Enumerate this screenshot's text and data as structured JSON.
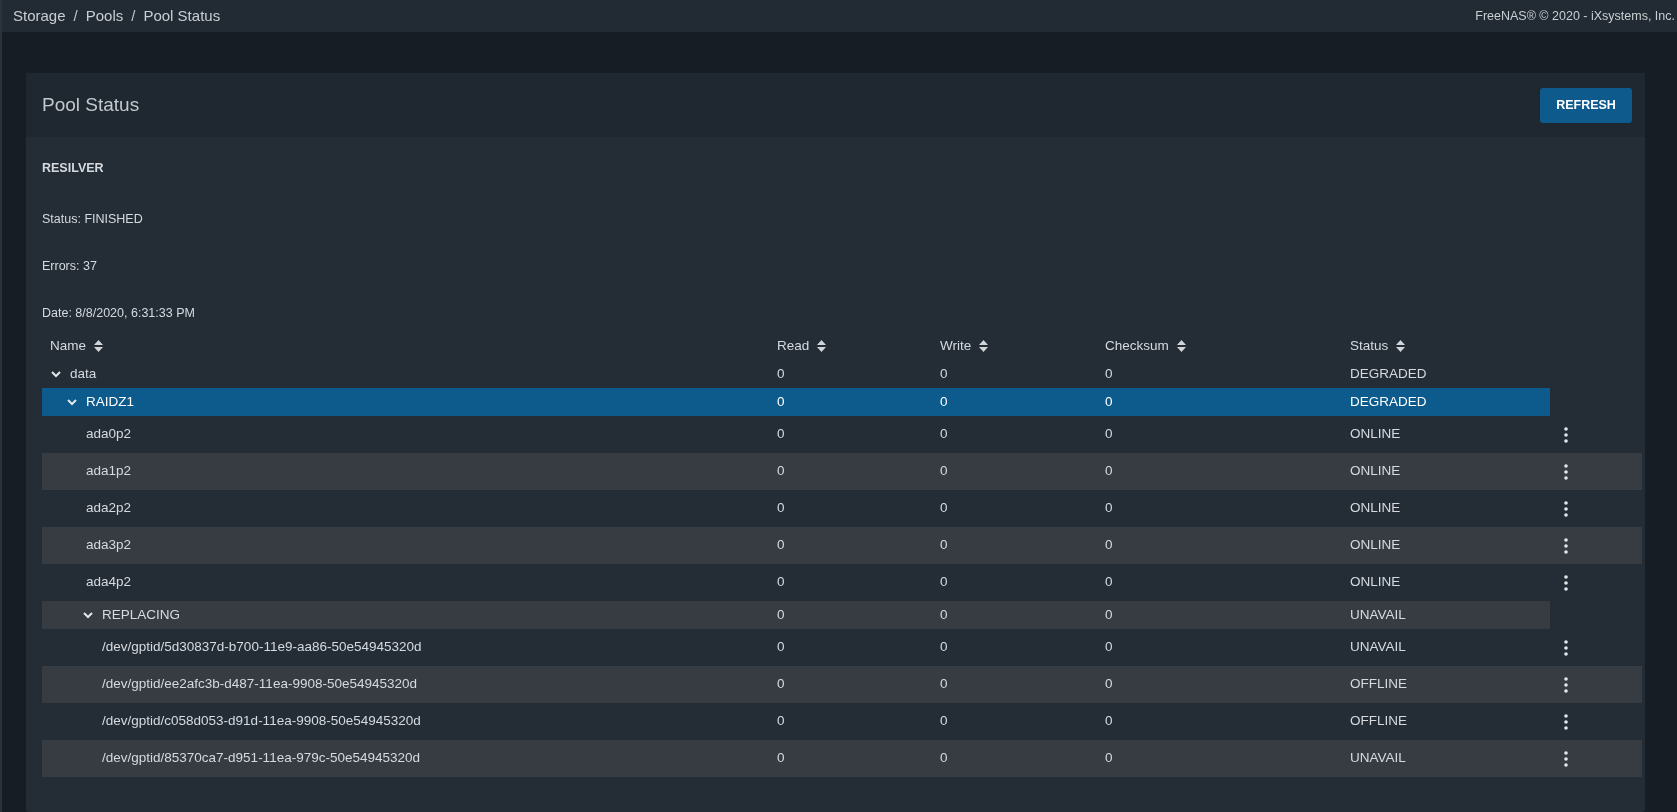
{
  "breadcrumbs": [
    "Storage",
    "Pools",
    "Pool Status"
  ],
  "breadcrumb_separator": "/",
  "copyright": "FreeNAS® © 2020 - iXsystems, Inc.",
  "card": {
    "title": "Pool Status",
    "refresh_button": "REFRESH"
  },
  "resilver": {
    "heading": "RESILVER",
    "lines": [
      "Status: FINISHED",
      "Errors: 37",
      "Date: 8/8/2020, 6:31:33 PM"
    ]
  },
  "table": {
    "columns": [
      "Name",
      "Read",
      "Write",
      "Checksum",
      "Status"
    ],
    "rows": [
      {
        "name": "data",
        "read": "0",
        "write": "0",
        "checksum": "0",
        "status": "DEGRADED",
        "selected": false,
        "expanded": true,
        "children": [
          {
            "name": "RAIDZ1",
            "read": "0",
            "write": "0",
            "checksum": "0",
            "status": "DEGRADED",
            "selected": true,
            "expanded": true,
            "children": [
              {
                "name": "ada0p2",
                "read": "0",
                "write": "0",
                "checksum": "0",
                "status": "ONLINE",
                "selected": false
              },
              {
                "name": "ada1p2",
                "read": "0",
                "write": "0",
                "checksum": "0",
                "status": "ONLINE",
                "selected": false
              },
              {
                "name": "ada2p2",
                "read": "0",
                "write": "0",
                "checksum": "0",
                "status": "ONLINE",
                "selected": false
              },
              {
                "name": "ada3p2",
                "read": "0",
                "write": "0",
                "checksum": "0",
                "status": "ONLINE",
                "selected": false
              },
              {
                "name": "ada4p2",
                "read": "0",
                "write": "0",
                "checksum": "0",
                "status": "ONLINE",
                "selected": false
              },
              {
                "name": "REPLACING",
                "read": "0",
                "write": "0",
                "checksum": "0",
                "status": "UNAVAIL",
                "selected": false,
                "expanded": true,
                "children": [
                  {
                    "name": "/dev/gptid/5d30837d-b700-11e9-aa86-50e54945320d",
                    "read": "0",
                    "write": "0",
                    "checksum": "0",
                    "status": "UNAVAIL",
                    "selected": false
                  },
                  {
                    "name": "/dev/gptid/ee2afc3b-d487-11ea-9908-50e54945320d",
                    "read": "0",
                    "write": "0",
                    "checksum": "0",
                    "status": "OFFLINE",
                    "selected": false
                  },
                  {
                    "name": "/dev/gptid/c058d053-d91d-11ea-9908-50e54945320d",
                    "read": "0",
                    "write": "0",
                    "checksum": "0",
                    "status": "OFFLINE",
                    "selected": false
                  },
                  {
                    "name": "/dev/gptid/85370ca7-d951-11ea-979c-50e54945320d",
                    "read": "0",
                    "write": "0",
                    "checksum": "0",
                    "status": "UNAVAIL",
                    "selected": false
                  }
                ]
              }
            ]
          }
        ]
      }
    ]
  }
}
